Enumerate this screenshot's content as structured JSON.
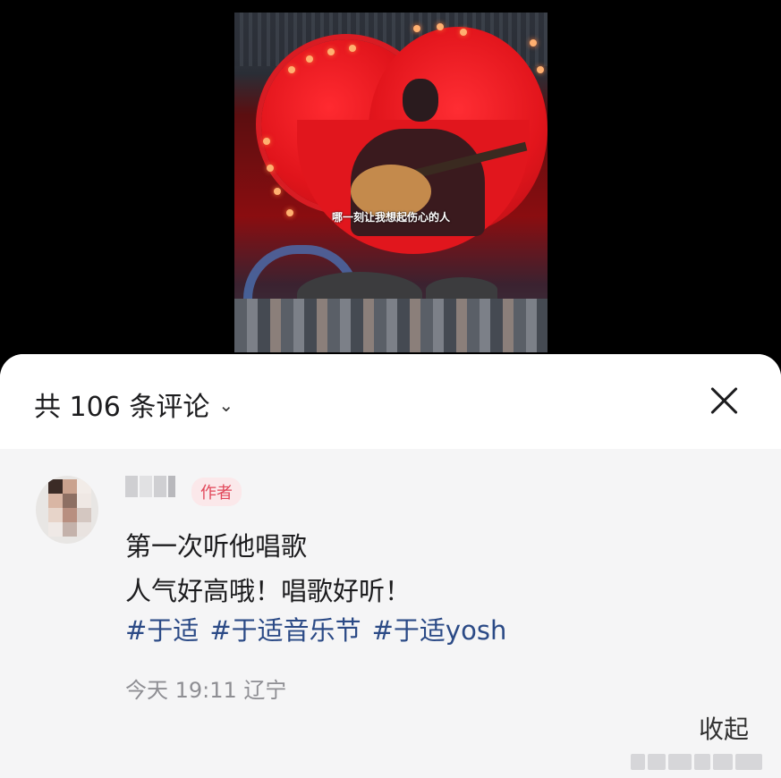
{
  "video": {
    "subtitle": "哪一刻让我想起伤心的人"
  },
  "comments_sheet": {
    "title": "共 106 条评论",
    "dropdown_icon": "chevron-down-icon",
    "close_icon": "close-icon"
  },
  "comment": {
    "badge": "作者",
    "line1": "第一次听他唱歌",
    "line2": "人气好高哦！唱歌好听！",
    "tags": [
      "#于适",
      "#于适音乐节",
      "#于适yosh"
    ],
    "time_location": "今天 19:11 辽宁",
    "collapse_label": "收起"
  },
  "colors": {
    "tag": "#2b4a86",
    "badge_text": "#e2475a",
    "badge_bg": "#fbe8ea"
  }
}
